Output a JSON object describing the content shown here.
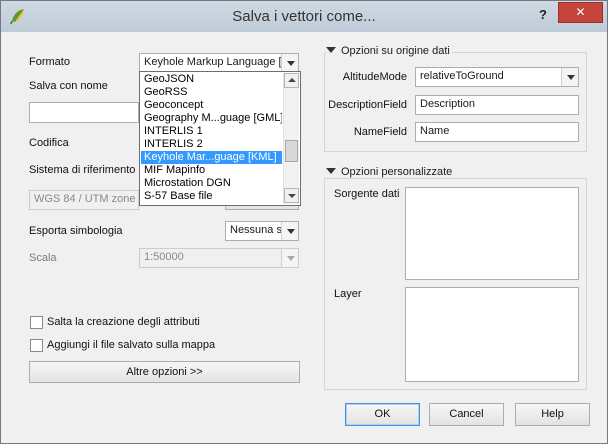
{
  "window": {
    "title": "Salva i vettori come...",
    "help_label": "?",
    "close_label": "✕"
  },
  "form": {
    "format_label": "Formato",
    "format_value": "Keyhole Markup Language [K",
    "save_as_label": "Salva con nome",
    "save_as_value": "",
    "encoding_label": "Codifica",
    "crs_label": "Sistema di riferimento",
    "crs_value": "WGS 84 / UTM zone 3",
    "symbology_label": "Esporta simbologia",
    "symbology_value": "Nessuna s",
    "scale_label": "Scala",
    "scale_value": "1:50000",
    "skip_attributes_label": "Salta la creazione degli attributi",
    "add_to_map_label": "Aggiungi il file salvato sulla mappa",
    "more_options_label": "Altre opzioni >>"
  },
  "format_dropdown": {
    "items": [
      "GeoJSON",
      "GeoRSS",
      "Geoconcept",
      "Geography M...guage [GML]",
      "INTERLIS 1",
      "INTERLIS 2",
      "Keyhole Mar...guage [KML]",
      "MIF Mapinfo",
      "Microstation DGN",
      "S-57 Base file"
    ],
    "selected_index": 6
  },
  "datasource_options": {
    "title": "Opzioni su origine dati",
    "altitude_mode_label": "AltitudeMode",
    "altitude_mode_value": "relativeToGround",
    "description_field_label": "DescriptionField",
    "description_field_value": "Description",
    "name_field_label": "NameField",
    "name_field_value": "Name"
  },
  "custom_options": {
    "title": "Opzioni personalizzate",
    "datasource_label": "Sorgente dati",
    "layer_label": "Layer"
  },
  "buttons": {
    "ok": "OK",
    "cancel": "Cancel",
    "help": "Help"
  },
  "colors": {
    "selection": "#3399ff",
    "close_button": "#c7443d",
    "titlebar": "#c5d1dd"
  }
}
